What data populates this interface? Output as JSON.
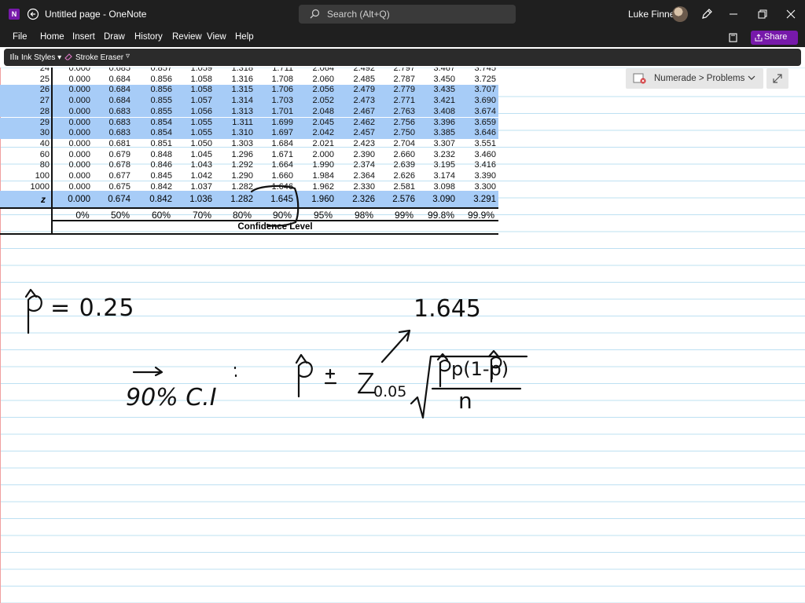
{
  "app": {
    "title": "Untitled page - OneNote",
    "icon_letter": "N",
    "search_placeholder": "Search (Alt+Q)",
    "user_name": "Luke Finney",
    "brand_color": "#7719aa"
  },
  "menu": {
    "items": [
      "File",
      "Home",
      "Insert",
      "Draw",
      "History",
      "Review",
      "View",
      "Help"
    ],
    "share_label": "Share"
  },
  "toolbar": {
    "ink_styles": "Ink Styles",
    "stroke_eraser": "Stroke Eraser"
  },
  "breadcrumb": {
    "text": "Numerade > Problems"
  },
  "t_table": {
    "rows": [
      {
        "df": "24",
        "values": [
          "0.000",
          "0.685",
          "0.857",
          "1.059",
          "1.318",
          "1.711",
          "2.064",
          "2.492",
          "2.797",
          "3.467",
          "3.745"
        ],
        "highlight": false
      },
      {
        "df": "25",
        "values": [
          "0.000",
          "0.684",
          "0.856",
          "1.058",
          "1.316",
          "1.708",
          "2.060",
          "2.485",
          "2.787",
          "3.450",
          "3.725"
        ],
        "highlight": false
      },
      {
        "df": "26",
        "values": [
          "0.000",
          "0.684",
          "0.856",
          "1.058",
          "1.315",
          "1.706",
          "2.056",
          "2.479",
          "2.779",
          "3.435",
          "3.707"
        ],
        "highlight": true
      },
      {
        "df": "27",
        "values": [
          "0.000",
          "0.684",
          "0.855",
          "1.057",
          "1.314",
          "1.703",
          "2.052",
          "2.473",
          "2.771",
          "3.421",
          "3.690"
        ],
        "highlight": true
      },
      {
        "df": "28",
        "values": [
          "0.000",
          "0.683",
          "0.855",
          "1.056",
          "1.313",
          "1.701",
          "2.048",
          "2.467",
          "2.763",
          "3.408",
          "3.674"
        ],
        "highlight": true
      },
      {
        "df": "29",
        "values": [
          "0.000",
          "0.683",
          "0.854",
          "1.055",
          "1.311",
          "1.699",
          "2.045",
          "2.462",
          "2.756",
          "3.396",
          "3.659"
        ],
        "highlight": true
      },
      {
        "df": "30",
        "values": [
          "0.000",
          "0.683",
          "0.854",
          "1.055",
          "1.310",
          "1.697",
          "2.042",
          "2.457",
          "2.750",
          "3.385",
          "3.646"
        ],
        "highlight": true
      },
      {
        "df": "40",
        "values": [
          "0.000",
          "0.681",
          "0.851",
          "1.050",
          "1.303",
          "1.684",
          "2.021",
          "2.423",
          "2.704",
          "3.307",
          "3.551"
        ],
        "highlight": false
      },
      {
        "df": "60",
        "values": [
          "0.000",
          "0.679",
          "0.848",
          "1.045",
          "1.296",
          "1.671",
          "2.000",
          "2.390",
          "2.660",
          "3.232",
          "3.460"
        ],
        "highlight": false
      },
      {
        "df": "80",
        "values": [
          "0.000",
          "0.678",
          "0.846",
          "1.043",
          "1.292",
          "1.664",
          "1.990",
          "2.374",
          "2.639",
          "3.195",
          "3.416"
        ],
        "highlight": false
      },
      {
        "df": "100",
        "values": [
          "0.000",
          "0.677",
          "0.845",
          "1.042",
          "1.290",
          "1.660",
          "1.984",
          "2.364",
          "2.626",
          "3.174",
          "3.390"
        ],
        "highlight": false
      },
      {
        "df": "1000",
        "values": [
          "0.000",
          "0.675",
          "0.842",
          "1.037",
          "1.282",
          "1.646",
          "1.962",
          "2.330",
          "2.581",
          "3.098",
          "3.300"
        ],
        "highlight": false
      }
    ],
    "z_label": "z",
    "z_values": [
      "0.000",
      "0.674",
      "0.842",
      "1.036",
      "1.282",
      "1.645",
      "1.960",
      "2.326",
      "2.576",
      "3.090",
      "3.291"
    ],
    "confidence_levels": [
      "0%",
      "50%",
      "60%",
      "70%",
      "80%",
      "90%",
      "95%",
      "98%",
      "99%",
      "99.8%",
      "99.9%"
    ],
    "confidence_title": "Confidence Level",
    "highlight_color": "#a7ccf7"
  },
  "ink_notes": {
    "p_hat_value": "= 0.25",
    "ci_label": "90% C.I",
    "z_value": "1.645",
    "z_subscript": "0.05",
    "formula_numerator": "p(1-p)",
    "formula_denominator": "n"
  }
}
